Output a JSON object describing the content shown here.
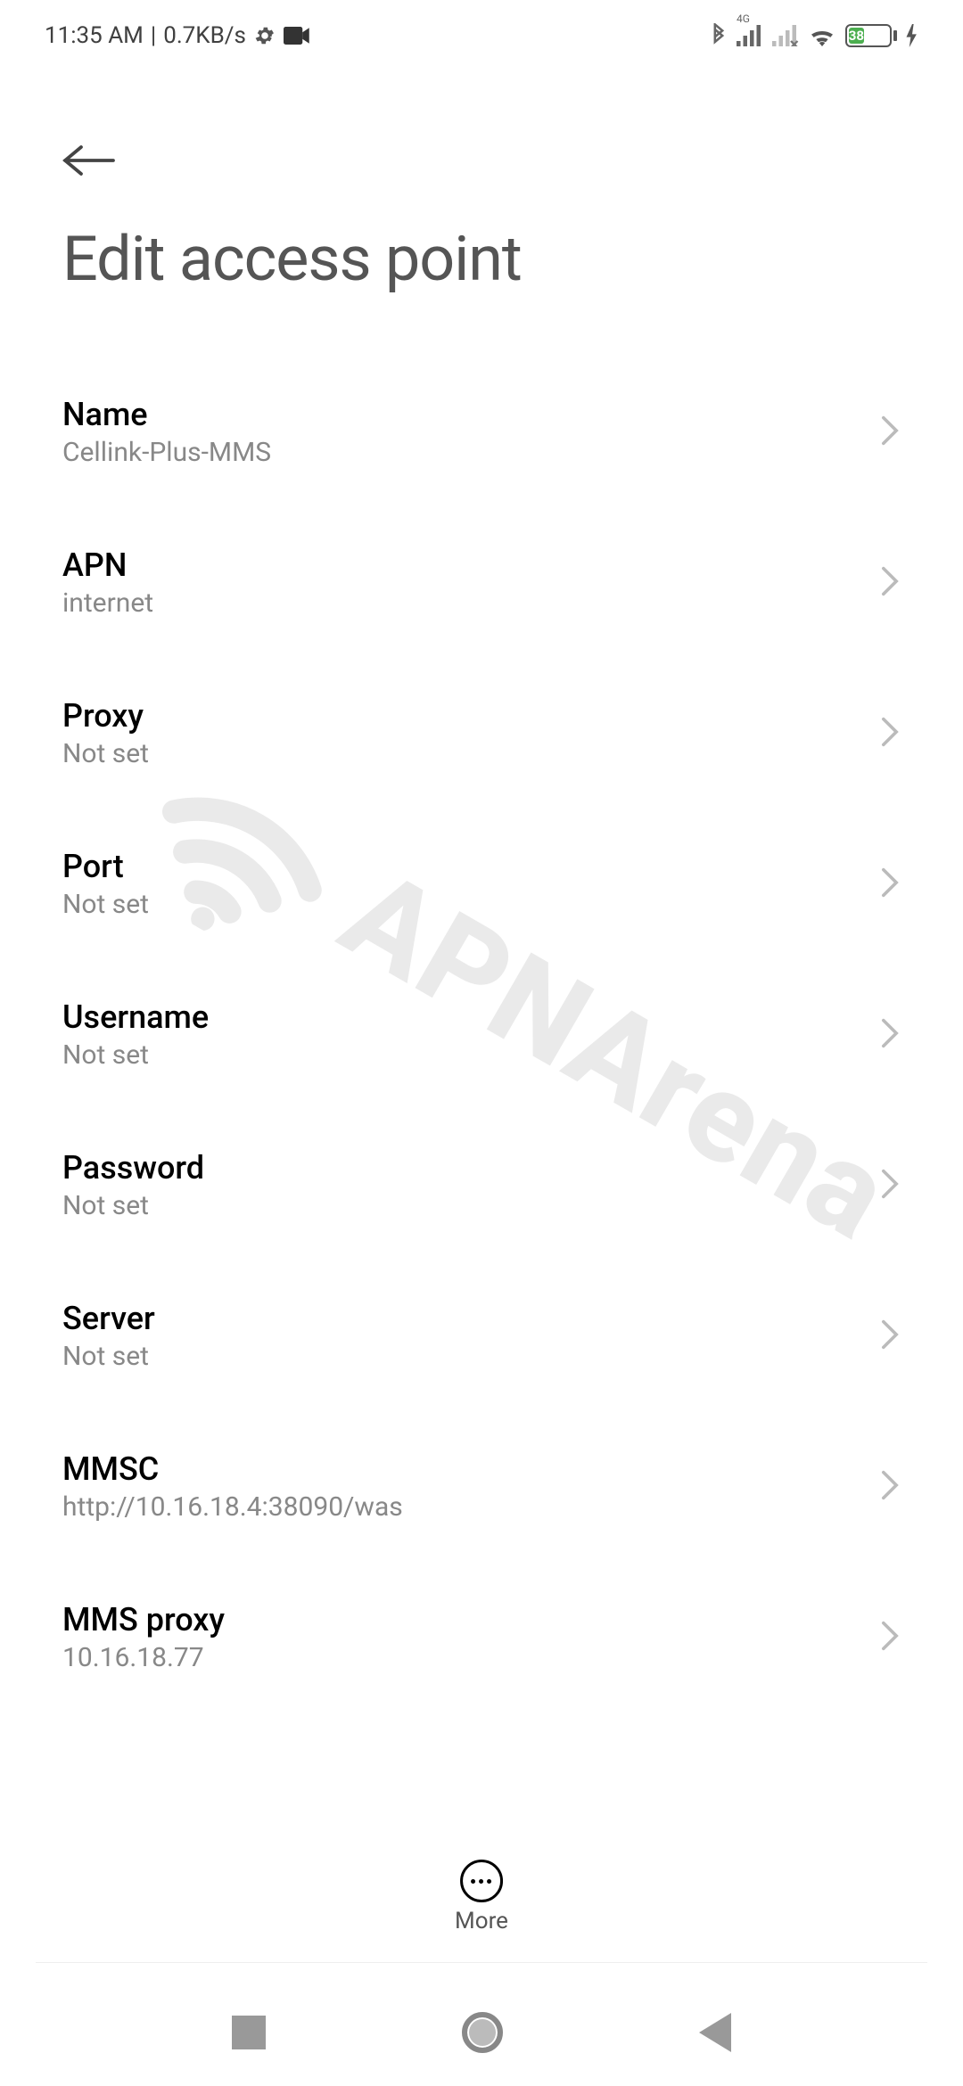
{
  "status": {
    "time": "11:35 AM",
    "speed": "0.7KB/s",
    "net_label": "4G",
    "battery_percent": 38,
    "battery_text": "38"
  },
  "header": {
    "title": "Edit access point"
  },
  "settings": [
    {
      "label": "Name",
      "value": "Cellink-Plus-MMS",
      "id": "name"
    },
    {
      "label": "APN",
      "value": "internet",
      "id": "apn"
    },
    {
      "label": "Proxy",
      "value": "Not set",
      "id": "proxy"
    },
    {
      "label": "Port",
      "value": "Not set",
      "id": "port"
    },
    {
      "label": "Username",
      "value": "Not set",
      "id": "username"
    },
    {
      "label": "Password",
      "value": "Not set",
      "id": "password"
    },
    {
      "label": "Server",
      "value": "Not set",
      "id": "server"
    },
    {
      "label": "MMSC",
      "value": "http://10.16.18.4:38090/was",
      "id": "mmsc"
    },
    {
      "label": "MMS proxy",
      "value": "10.16.18.77",
      "id": "mms-proxy"
    }
  ],
  "fab": {
    "label": "More"
  },
  "watermark": {
    "text": "APNArena"
  }
}
